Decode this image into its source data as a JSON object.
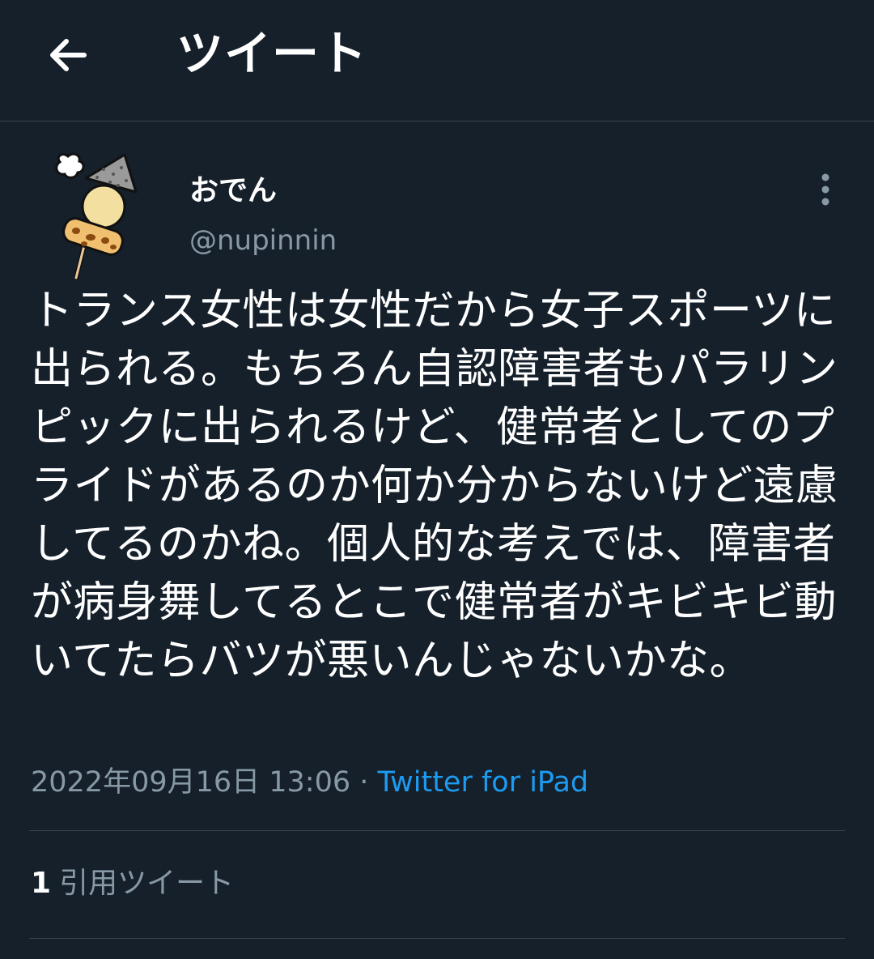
{
  "header": {
    "title": "ツイート",
    "back_icon": "arrow-left-icon"
  },
  "tweet": {
    "author": {
      "display_name": "おでん",
      "handle": "@nupinnin",
      "avatar_icon": "oden-skewer-avatar"
    },
    "more_icon": "more-vertical-icon",
    "text": "トランス女性は女性だから女子スポーツに出られる。もちろん自認障害者もパラリンピックに出られるけど、健常者としてのプライドがあるのか何か分からないけど遠慮してるのかね。個人的な考えでは、障害者が病身舞してるとこで健常者がキビキビ動いてたらバツが悪いんじゃないかな。",
    "timestamp": "2022年09月16日 13:06",
    "separator": " · ",
    "source": "Twitter for iPad"
  },
  "stats": {
    "quote_count": "1",
    "quote_label": "引用ツイート"
  },
  "colors": {
    "background": "#15202b",
    "divider": "#38444d",
    "secondary_text": "#8899a6",
    "link": "#1d9bf0"
  }
}
